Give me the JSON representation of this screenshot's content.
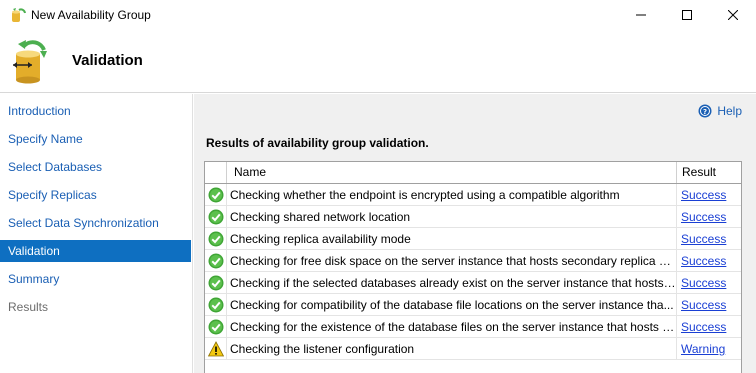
{
  "window": {
    "title": "New Availability Group",
    "icon": "availability-group-icon"
  },
  "header": {
    "title": "Validation",
    "icon": "wizard-database-icon"
  },
  "sidebar": {
    "items": [
      {
        "label": "Introduction",
        "state": "link"
      },
      {
        "label": "Specify Name",
        "state": "link"
      },
      {
        "label": "Select Databases",
        "state": "link"
      },
      {
        "label": "Specify Replicas",
        "state": "link"
      },
      {
        "label": "Select Data Synchronization",
        "state": "link"
      },
      {
        "label": "Validation",
        "state": "active"
      },
      {
        "label": "Summary",
        "state": "link"
      },
      {
        "label": "Results",
        "state": "disabled"
      }
    ]
  },
  "main": {
    "help_label": "Help",
    "results_heading": "Results of availability group validation.",
    "columns": {
      "name": "Name",
      "result": "Result"
    },
    "rows": [
      {
        "status": "success",
        "name": "Checking whether the endpoint is encrypted using a compatible algorithm",
        "result": "Success"
      },
      {
        "status": "success",
        "name": "Checking shared network location",
        "result": "Success"
      },
      {
        "status": "success",
        "name": "Checking replica availability mode",
        "result": "Success"
      },
      {
        "status": "success",
        "name": "Checking for free disk space on the server instance that hosts secondary replica S...",
        "result": "Success"
      },
      {
        "status": "success",
        "name": "Checking if the selected databases already exist on the server instance that hosts s...",
        "result": "Success"
      },
      {
        "status": "success",
        "name": "Checking for compatibility of the database file locations on the server instance tha...",
        "result": "Success"
      },
      {
        "status": "success",
        "name": "Checking for the existence of the database files on the server instance that hosts s...",
        "result": "Success"
      },
      {
        "status": "warning",
        "name": "Checking the listener configuration",
        "result": "Warning"
      }
    ]
  },
  "colors": {
    "accent": "#0e6fc1",
    "link": "#1a5fb4",
    "success": "#3fa535",
    "warning": "#f2c811"
  }
}
